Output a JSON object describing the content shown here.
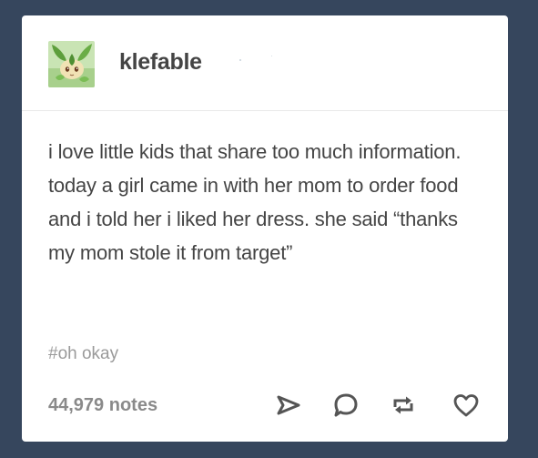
{
  "post": {
    "username": "klefable",
    "body_text": "i love little kids that share too much information. today a girl came in with her mom to order food and i told her i liked her dress. she said “thanks my mom stole it from target”",
    "tags": "#oh okay",
    "notes": "44,979 notes"
  },
  "icons": {
    "avatar": "leafeon-avatar",
    "share": "paper-plane-icon",
    "reply": "speech-bubble-icon",
    "reblog": "reblog-arrows-icon",
    "like": "heart-icon"
  },
  "colors": {
    "background": "#36465d",
    "card": "#ffffff",
    "text": "#444444",
    "muted": "#9a9a9a",
    "icon": "#555555"
  }
}
